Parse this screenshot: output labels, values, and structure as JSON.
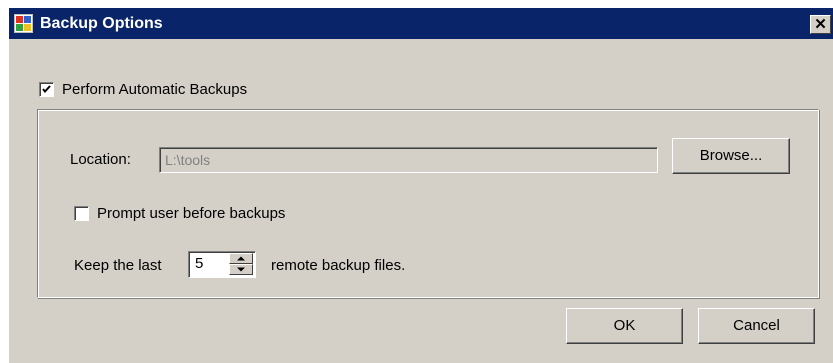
{
  "window": {
    "title": "Backup Options",
    "close_glyph": "✕",
    "icon": "app-window-icon",
    "titlebar_color": "#0a246a",
    "face_color": "#d4d0c8"
  },
  "auto_backup": {
    "label": "Perform Automatic Backups",
    "checked": true
  },
  "location": {
    "label": "Location:",
    "value": "L:\\tools",
    "browse_label": "Browse..."
  },
  "prompt_user": {
    "label": "Prompt user before backups",
    "checked": false
  },
  "keep": {
    "prefix": "Keep the last",
    "value": "5",
    "suffix": "remote backup files."
  },
  "buttons": {
    "ok_label": "OK",
    "cancel_label": "Cancel"
  }
}
